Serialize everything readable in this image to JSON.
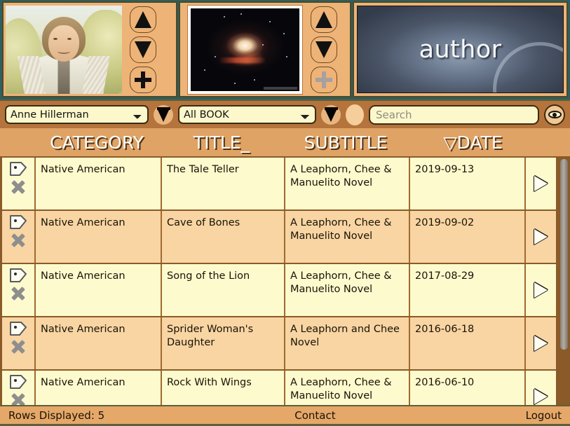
{
  "media": {
    "author_panel": {
      "thumbnail_name": "author-portrait-photo",
      "nav_up_label": "▲",
      "nav_down_label": "▼",
      "nav_add_label": "+"
    },
    "book_panel": {
      "thumbnail_name": "book-cover-galaxy-photo",
      "nav_up_label": "▲",
      "nav_down_label": "▼",
      "nav_add_label": "+"
    },
    "title_panel": {
      "label": "author"
    }
  },
  "toolbar": {
    "author_select_value": "Anne Hillerman",
    "author_filter_icon": "funnel-icon",
    "book_select_value": "All BOOK",
    "book_filter_icon": "funnel-icon",
    "blank_oval_name": "status-oval",
    "search_placeholder": "Search",
    "search_value": "",
    "eye_icon": "eye-icon"
  },
  "columns": {
    "icons": "",
    "category": "CATEGORY",
    "title": "TITLE_",
    "subtitle": "SUBTITLE",
    "date": "▽DATE"
  },
  "rows": [
    {
      "category": "Native American",
      "title": "The Tale Teller",
      "subtitle": "A Leaphorn, Chee & Manuelito Novel",
      "date": "2019-09-13"
    },
    {
      "category": "Native American",
      "title": "Cave of Bones",
      "subtitle": "A Leaphorn, Chee & Manuelito Novel",
      "date": "2019-09-02"
    },
    {
      "category": "Native American",
      "title": "Song of the Lion",
      "subtitle": "A Leaphorn, Chee & Manuelito Novel",
      "date": "2017-08-29"
    },
    {
      "category": "Native American",
      "title": "Sprider Woman's Daughter",
      "subtitle": "A Leaphorn and Chee Novel",
      "date": "2016-06-18"
    },
    {
      "category": "Native American",
      "title": "Rock With Wings",
      "subtitle": "A Leaphorn, Chee & Manuelito Novel",
      "date": "2016-06-10"
    }
  ],
  "footer": {
    "rows_displayed": "Rows Displayed: 5",
    "contact": "Contact",
    "logout": "Logout"
  },
  "colors": {
    "toolbar_bg": "#b4743c",
    "header_bg": "#e0a366",
    "panel_bg": "#eeb377",
    "row_odd": "#fdfbcd",
    "row_even": "#f8d5a2",
    "footer_bg": "#e5a868",
    "page_border": "#2f5f5f"
  }
}
